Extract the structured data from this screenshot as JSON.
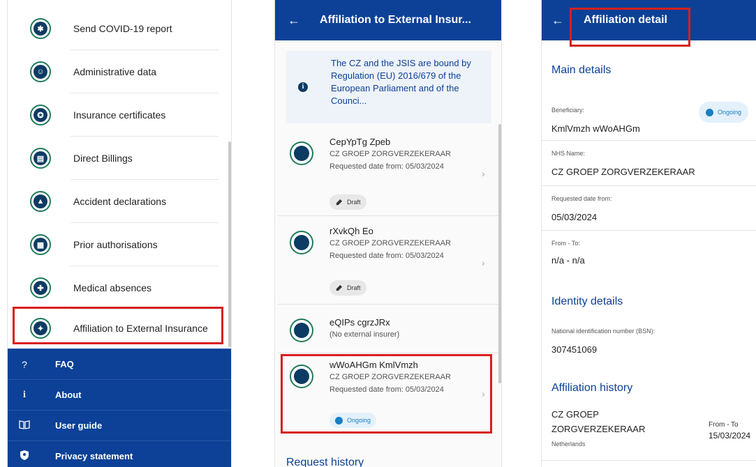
{
  "menu": {
    "items": [
      {
        "label": "Send COVID-19 report",
        "icon": "virus-icon"
      },
      {
        "label": "Administrative data",
        "icon": "profile-icon"
      },
      {
        "label": "Insurance certificates",
        "icon": "certificate-icon"
      },
      {
        "label": "Direct Billings",
        "icon": "billing-icon"
      },
      {
        "label": "Accident declarations",
        "icon": "warning-icon"
      },
      {
        "label": "Prior authorisations",
        "icon": "document-icon"
      },
      {
        "label": "Medical absences",
        "icon": "medical-icon"
      },
      {
        "label": "Affiliation to External Insurance",
        "icon": "puzzle-icon"
      }
    ],
    "bottom_nav": [
      {
        "label": "FAQ",
        "glyph": "?"
      },
      {
        "label": "About",
        "glyph": "i"
      },
      {
        "label": "User guide",
        "glyph": "book"
      },
      {
        "label": "Privacy statement",
        "glyph": "shield"
      }
    ]
  },
  "list_screen": {
    "back": "←",
    "title": "Affiliation to External Insur...",
    "notice": "The CZ and the JSIS are bound by Regulation (EU) 2016/679 of the European Parliament and of the Counci...",
    "notice_icon": "info-icon",
    "cards": [
      {
        "name": "CepYpTg Zpeb",
        "insurer": "CZ GROEP ZORGVERZEKERAAR",
        "date": "Requested date from: 05/03/2024",
        "status": "Draft"
      },
      {
        "name": "rXvkQh Eo",
        "insurer": "CZ GROEP ZORGVERZEKERAAR",
        "date": "Requested date from: 05/03/2024",
        "status": "Draft"
      },
      {
        "name": "eQIPs cgrzJRx",
        "insurer": "(No external insurer)",
        "date": "",
        "status": ""
      },
      {
        "name": "wWoAHGm KmlVmzh",
        "insurer": "CZ GROEP ZORGVERZEKERAAR",
        "date": "Requested date from: 05/03/2024",
        "status": "Ongoing"
      }
    ],
    "request_history": "Request history"
  },
  "detail_screen": {
    "back": "←",
    "title": "Affiliation detail",
    "main_details": "Main details",
    "beneficiary_label": "Beneficiary:",
    "beneficiary_value": "KmlVmzh wWoAHGm",
    "status": "Ongoing",
    "nhs_label": "NHS Name:",
    "nhs_value": "CZ GROEP ZORGVERZEKERAAR",
    "req_date_label": "Requested date from:",
    "req_date_value": "05/03/2024",
    "from_to_label": "From - To:",
    "from_to_value": "n/a - n/a",
    "identity_details": "Identity details",
    "bsn_label": "National identification number (BSN):",
    "bsn_value": "307451069",
    "affiliation_history": "Affiliation history",
    "hist_insurer_line1": "CZ GROEP",
    "hist_insurer_line2": "ZORGVERZEKERAAR",
    "hist_country": "Netherlands",
    "hist_from_to_label": "From - To",
    "hist_from_to_value": "15/03/2024"
  },
  "colors": {
    "brand_blue": "#0c4197",
    "icon_navy": "#0c3b63",
    "icon_ring_green": "#1f7a5e",
    "highlight_red": "#d81e1e",
    "ongoing_blue": "#1a7ec2"
  }
}
